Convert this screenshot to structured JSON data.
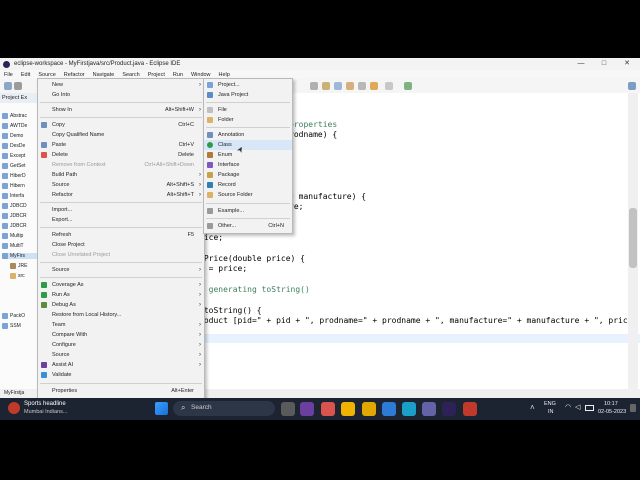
{
  "window": {
    "title": "eclipse-workspace - MyFirstjava/src/Product.java - Eclipse IDE",
    "controls": [
      "—",
      "□",
      "✕"
    ]
  },
  "menubar": [
    "File",
    "Edit",
    "Source",
    "Refactor",
    "Navigate",
    "Search",
    "Project",
    "Run",
    "Window",
    "Help"
  ],
  "explorer": {
    "tab_label": "Project Ex",
    "items": [
      "Abstrac",
      "AWTDe",
      "Demo",
      "DesDe",
      "Except",
      "GetSet",
      "HiberD",
      "Hibern",
      "Interfa",
      "JDBCD",
      "JDBCR",
      "JDBCR",
      "Multip",
      "MultiT",
      "MyFirs",
      "JRE",
      "src",
      "PackO",
      "SSM"
    ],
    "status_label": "MyFirstja"
  },
  "editor": {
    "lines": [
      {
        "t": "properties",
        "c": "cm"
      },
      {
        "t": "rodname) {",
        "c": ""
      },
      {
        "t": "g manufacture) {",
        "c": ""
      },
      {
        "t": "re;",
        "c": ""
      },
      {
        "t": "rice;",
        "c": ""
      },
      {
        "t": "tPrice(double price) {",
        "c": ""
      },
      {
        "t": "e = price;",
        "c": ""
      },
      {
        "t": "y generating toString()",
        "c": "cm"
      },
      {
        "t": " toString() {",
        "c": ""
      },
      {
        "t": "roduct [pid=\" + pid + \", prodname=\" + prodname + \", manufacture=\" + manufacture + \", price=",
        "c": ""
      }
    ]
  },
  "context_menu": {
    "items": [
      {
        "label": "New",
        "shortcut": "",
        "submenu": true,
        "disabled": false
      },
      {
        "label": "Go Into",
        "shortcut": "",
        "submenu": false,
        "disabled": false
      },
      {
        "label": "Show In",
        "shortcut": "Alt+Shift+W",
        "submenu": true,
        "disabled": false
      },
      {
        "label": "Copy",
        "shortcut": "Ctrl+C",
        "submenu": false,
        "disabled": false
      },
      {
        "label": "Copy Qualified Name",
        "shortcut": "",
        "submenu": false,
        "disabled": false
      },
      {
        "label": "Paste",
        "shortcut": "Ctrl+V",
        "submenu": false,
        "disabled": false
      },
      {
        "label": "Delete",
        "shortcut": "Delete",
        "submenu": false,
        "disabled": false
      },
      {
        "label": "Remove from Context",
        "shortcut": "Ctrl+Alt+Shift+Down",
        "submenu": false,
        "disabled": true
      },
      {
        "label": "Build Path",
        "shortcut": "",
        "submenu": true,
        "disabled": false
      },
      {
        "label": "Source",
        "shortcut": "Alt+Shift+S",
        "submenu": true,
        "disabled": false
      },
      {
        "label": "Refactor",
        "shortcut": "Alt+Shift+T",
        "submenu": true,
        "disabled": false
      },
      {
        "label": "Import...",
        "shortcut": "",
        "submenu": false,
        "disabled": false
      },
      {
        "label": "Export...",
        "shortcut": "",
        "submenu": false,
        "disabled": false
      },
      {
        "label": "Refresh",
        "shortcut": "F5",
        "submenu": false,
        "disabled": false
      },
      {
        "label": "Close Project",
        "shortcut": "",
        "submenu": false,
        "disabled": false
      },
      {
        "label": "Close Unrelated Project",
        "shortcut": "",
        "submenu": false,
        "disabled": true
      },
      {
        "label": "Source",
        "shortcut": "",
        "submenu": true,
        "disabled": false
      },
      {
        "label": "Coverage As",
        "shortcut": "",
        "submenu": true,
        "disabled": false
      },
      {
        "label": "Run As",
        "shortcut": "",
        "submenu": true,
        "disabled": false
      },
      {
        "label": "Debug As",
        "shortcut": "",
        "submenu": true,
        "disabled": false
      },
      {
        "label": "Restore from Local History...",
        "shortcut": "",
        "submenu": false,
        "disabled": false
      },
      {
        "label": "Team",
        "shortcut": "",
        "submenu": true,
        "disabled": false
      },
      {
        "label": "Compare With",
        "shortcut": "",
        "submenu": true,
        "disabled": false
      },
      {
        "label": "Configure",
        "shortcut": "",
        "submenu": true,
        "disabled": false
      },
      {
        "label": "Source",
        "shortcut": "",
        "submenu": true,
        "disabled": false
      },
      {
        "label": "Assist AI",
        "shortcut": "",
        "submenu": true,
        "disabled": false
      },
      {
        "label": "Validate",
        "shortcut": "",
        "submenu": false,
        "disabled": false
      },
      {
        "label": "Properties",
        "shortcut": "Alt+Enter",
        "submenu": false,
        "disabled": false
      }
    ]
  },
  "submenu_new": {
    "items": [
      {
        "label": "Project...",
        "shortcut": "",
        "icon": "project-icon"
      },
      {
        "label": "Java Project",
        "shortcut": "",
        "icon": "java-project-icon"
      },
      {
        "label": "File",
        "shortcut": "",
        "icon": "file-icon"
      },
      {
        "label": "Folder",
        "shortcut": "",
        "icon": "folder-icon"
      },
      {
        "label": "Annotation",
        "shortcut": "",
        "icon": "annotation-icon"
      },
      {
        "label": "Class",
        "shortcut": "",
        "icon": "class-icon"
      },
      {
        "label": "Enum",
        "shortcut": "",
        "icon": "enum-icon"
      },
      {
        "label": "Interface",
        "shortcut": "",
        "icon": "interface-icon"
      },
      {
        "label": "Package",
        "shortcut": "",
        "icon": "package-icon"
      },
      {
        "label": "Record",
        "shortcut": "",
        "icon": "record-icon"
      },
      {
        "label": "Source Folder",
        "shortcut": "",
        "icon": "source-folder-icon"
      },
      {
        "label": "Example...",
        "shortcut": "",
        "icon": "example-icon"
      },
      {
        "label": "Other...",
        "shortcut": "Ctrl+N",
        "icon": "other-icon"
      }
    ]
  },
  "taskbar": {
    "news_title": "Sports headline",
    "news_sub": "Mumbai Indians...",
    "search_placeholder": "Search",
    "lang_top": "ENG",
    "lang_bottom": "IN",
    "time": "10:17",
    "date": "02-05-2023"
  },
  "colors": {
    "keyword": "#7f0055",
    "comment": "#3f7f5f",
    "string": "#2a00ff",
    "menu_highlight": "#d7e7f7"
  }
}
